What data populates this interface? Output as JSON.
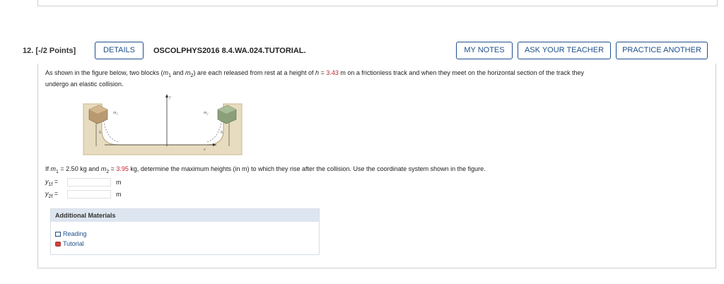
{
  "question": {
    "number_label": "12.",
    "points": "[-/2 Points]",
    "details_label": "DETAILS",
    "problem_code": "OSCOLPHYS2016 8.4.WA.024.TUTORIAL.",
    "actions": {
      "my_notes": "MY NOTES",
      "ask_teacher": "ASK YOUR TEACHER",
      "practice_another": "PRACTICE ANOTHER"
    }
  },
  "body": {
    "para1_part1": "As shown in the figure below, two blocks (",
    "m1": "m",
    "m1_sub": "1",
    "and": " and ",
    "m2": "m",
    "m2_sub": "2",
    "para1_part2": ") are each released from rest at a height of ",
    "h_sym": "h",
    "equals": " = ",
    "h_value": "3.43",
    "para1_part3": " m on a frictionless track and when they meet on the horizontal section of the track they",
    "para1_line2": "undergo an elastic collision.",
    "para2_if": "If ",
    "m1_value_text": " = 2.50 kg and ",
    "m2_value": "3.95",
    "para2_rest": " kg, determine the maximum heights (in m) to which they rise after the collision. Use the coordinate system shown in the figure."
  },
  "answers": [
    {
      "label_sym": "y",
      "label_sub": "1f",
      "label_eq": " =",
      "value": "",
      "unit": "m"
    },
    {
      "label_sym": "y",
      "label_sub": "2f",
      "label_eq": " =",
      "value": "",
      "unit": "m"
    }
  ],
  "figure": {
    "labels": {
      "m1": "m",
      "m1_sub": "1",
      "m2": "m",
      "m2_sub": "2",
      "h": "h",
      "y": "y",
      "x": "x"
    },
    "colors": {
      "track": "#e8dcc0",
      "block1": "#b99a70",
      "block2": "#8aa07a"
    }
  },
  "additional": {
    "heading": "Additional Materials",
    "links": [
      {
        "label": "Reading",
        "icon": "book-icon"
      },
      {
        "label": "Tutorial",
        "icon": "tutorial-icon"
      }
    ]
  }
}
